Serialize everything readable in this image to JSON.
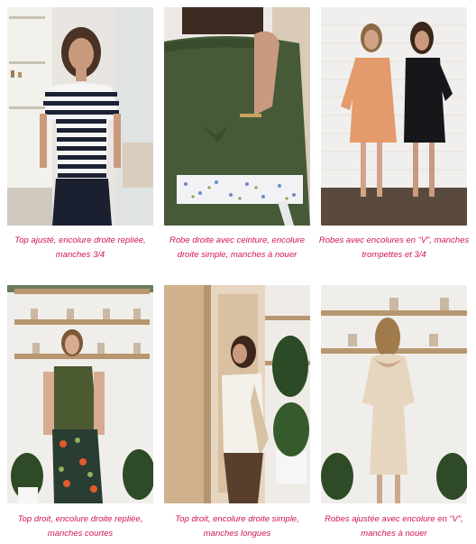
{
  "accent_color": "#d0135a",
  "photos": [
    {
      "caption": "Top ajusté, encolure droite repliée, manches 3/4",
      "icon": "striped-top-photo"
    },
    {
      "caption": "Robe droite avec ceinture, encolure droite simple, manches à nouer",
      "icon": "green-dress-photo"
    },
    {
      "caption": "Robes avec encolures en “V”, manches trompettes et 3/4",
      "icon": "two-dresses-photo"
    },
    {
      "caption": "Top droit, encolure droite repliée, manches courtes",
      "icon": "green-top-photo"
    },
    {
      "caption": "Top droit, encolure droite simple, manches longues",
      "icon": "white-top-photo"
    },
    {
      "caption": "Robes ajustée avec encolure en “V”, manches à nouer",
      "icon": "beige-dress-photo"
    }
  ]
}
